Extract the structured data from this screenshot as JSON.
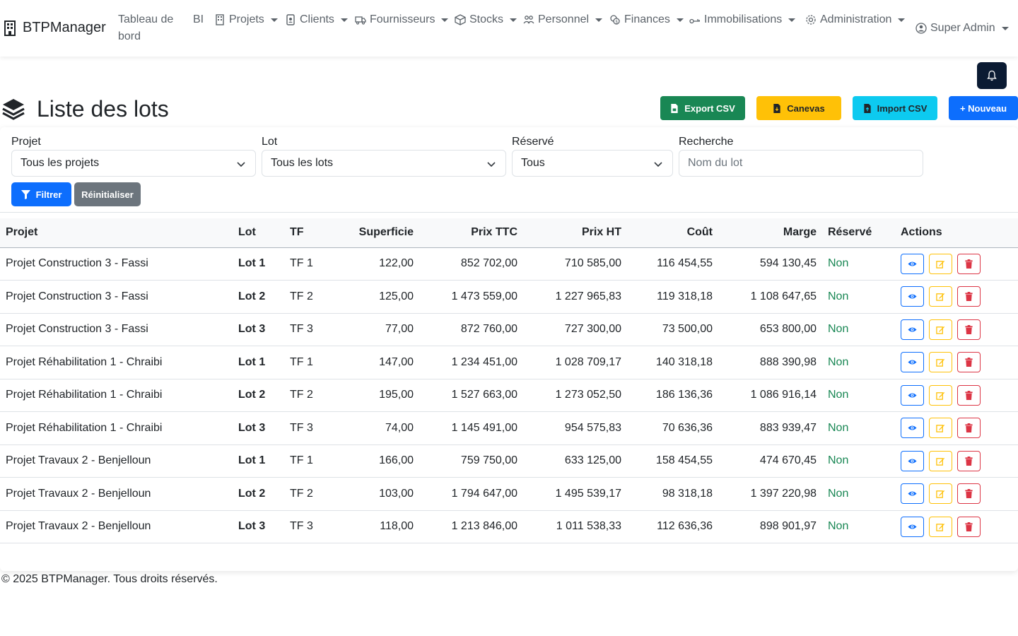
{
  "brand": {
    "name": "BTPManager",
    "icon": "building-icon"
  },
  "nav": {
    "dashboard": "Tableau de bord",
    "bi": "BI",
    "projets": "Projets",
    "clients": "Clients",
    "fournisseurs": "Fournisseurs",
    "stocks": "Stocks",
    "personnel": "Personnel",
    "finances": "Finances",
    "immobilisations": "Immobilisations",
    "administration": "Administration",
    "user": "Super Admin"
  },
  "header": {
    "title": "Liste des lots",
    "export": "Export CSV",
    "canevas": "Canevas",
    "import": "Import CSV",
    "new": "+ Nouveau"
  },
  "filters": {
    "projet_label": "Projet",
    "projet_value": "Tous les projets",
    "lot_label": "Lot",
    "lot_value": "Tous les lots",
    "reserve_label": "Réservé",
    "reserve_value": "Tous",
    "search_label": "Recherche",
    "search_placeholder": "Nom du lot",
    "filter_button": "Filtrer",
    "reset_button": "Réinitialiser"
  },
  "table": {
    "columns": [
      "Projet",
      "Lot",
      "TF",
      "Superficie",
      "Prix TTC",
      "Prix HT",
      "Coût",
      "Marge",
      "Réservé",
      "Actions"
    ],
    "rows": [
      [
        "Projet Construction 3 - Fassi",
        "Lot 1",
        "TF 1",
        "122,00",
        "852 702,00",
        "710 585,00",
        "116 454,55",
        "594 130,45",
        "Non"
      ],
      [
        "Projet Construction 3 - Fassi",
        "Lot 2",
        "TF 2",
        "125,00",
        "1 473 559,00",
        "1 227 965,83",
        "119 318,18",
        "1 108 647,65",
        "Non"
      ],
      [
        "Projet Construction 3 - Fassi",
        "Lot 3",
        "TF 3",
        "77,00",
        "872 760,00",
        "727 300,00",
        "73 500,00",
        "653 800,00",
        "Non"
      ],
      [
        "Projet Réhabilitation 1 - Chraibi",
        "Lot 1",
        "TF 1",
        "147,00",
        "1 234 451,00",
        "1 028 709,17",
        "140 318,18",
        "888 390,98",
        "Non"
      ],
      [
        "Projet Réhabilitation 1 - Chraibi",
        "Lot 2",
        "TF 2",
        "195,00",
        "1 527 663,00",
        "1 273 052,50",
        "186 136,36",
        "1 086 916,14",
        "Non"
      ],
      [
        "Projet Réhabilitation 1 - Chraibi",
        "Lot 3",
        "TF 3",
        "74,00",
        "1 145 491,00",
        "954 575,83",
        "70 636,36",
        "883 939,47",
        "Non"
      ],
      [
        "Projet Travaux 2 - Benjelloun",
        "Lot 1",
        "TF 1",
        "166,00",
        "759 750,00",
        "633 125,00",
        "158 454,55",
        "474 670,45",
        "Non"
      ],
      [
        "Projet Travaux 2 - Benjelloun",
        "Lot 2",
        "TF 2",
        "103,00",
        "1 794 647,00",
        "1 495 539,17",
        "98 318,18",
        "1 397 220,98",
        "Non"
      ],
      [
        "Projet Travaux 2 - Benjelloun",
        "Lot 3",
        "TF 3",
        "118,00",
        "1 213 846,00",
        "1 011 538,33",
        "112 636,36",
        "898 901,97",
        "Non"
      ]
    ]
  },
  "footer": "© 2025 BTPManager. Tous droits réservés.",
  "colors": {
    "primary": "#0d6efd",
    "success": "#198754",
    "warning": "#ffc107",
    "info": "#0dcaf0",
    "danger": "#dc3545",
    "secondary": "#6c757d",
    "bell_bg": "#0b1b33"
  }
}
